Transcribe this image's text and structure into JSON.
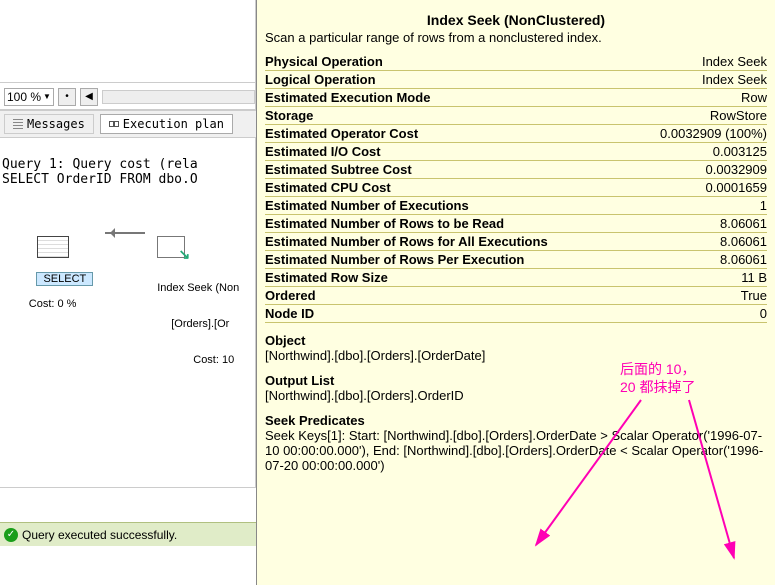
{
  "zoom": {
    "value": "100 %",
    "dot": "•"
  },
  "tabs": {
    "messages": "Messages",
    "plan": "Execution plan"
  },
  "query_header_1": "Query 1: Query cost (rela",
  "query_header_2": "SELECT OrderID FROM dbo.O",
  "diagram": {
    "select_label": "SELECT",
    "select_cost": "Cost: 0 %",
    "seek_line1": "Index Seek (Non",
    "seek_line2": "[Orders].[Or",
    "seek_line3": "Cost: 10"
  },
  "status": {
    "text": "Query executed successfully."
  },
  "tooltip": {
    "title": "Index Seek (NonClustered)",
    "desc": "Scan a particular range of rows from a nonclustered index.",
    "rows": [
      {
        "k": "Physical Operation",
        "v": "Index Seek"
      },
      {
        "k": "Logical Operation",
        "v": "Index Seek"
      },
      {
        "k": "Estimated Execution Mode",
        "v": "Row"
      },
      {
        "k": "Storage",
        "v": "RowStore"
      },
      {
        "k": "Estimated Operator Cost",
        "v": "0.0032909 (100%)"
      },
      {
        "k": "Estimated I/O Cost",
        "v": "0.003125"
      },
      {
        "k": "Estimated Subtree Cost",
        "v": "0.0032909"
      },
      {
        "k": "Estimated CPU Cost",
        "v": "0.0001659"
      },
      {
        "k": "Estimated Number of Executions",
        "v": "1"
      },
      {
        "k": "Estimated Number of Rows to be Read",
        "v": "8.06061"
      },
      {
        "k": "Estimated Number of Rows for All Executions",
        "v": "8.06061"
      },
      {
        "k": "Estimated Number of Rows Per Execution",
        "v": "8.06061"
      },
      {
        "k": "Estimated Row Size",
        "v": "11 B"
      },
      {
        "k": "Ordered",
        "v": "True"
      },
      {
        "k": "Node ID",
        "v": "0"
      }
    ],
    "object_h": "Object",
    "object_v": "[Northwind].[dbo].[Orders].[OrderDate]",
    "output_h": "Output List",
    "output_v": "[Northwind].[dbo].[Orders].OrderID",
    "seek_h": "Seek Predicates",
    "seek_v": "Seek Keys[1]: Start: [Northwind].[dbo].[Orders].OrderDate > Scalar Operator('1996-07-10 00:00:00.000'), End: [Northwind].[dbo].[Orders].OrderDate < Scalar Operator('1996-07-20 00:00:00.000')"
  },
  "annotation": {
    "line1": "后面的 10，",
    "line2": "20 都抹掉了"
  }
}
